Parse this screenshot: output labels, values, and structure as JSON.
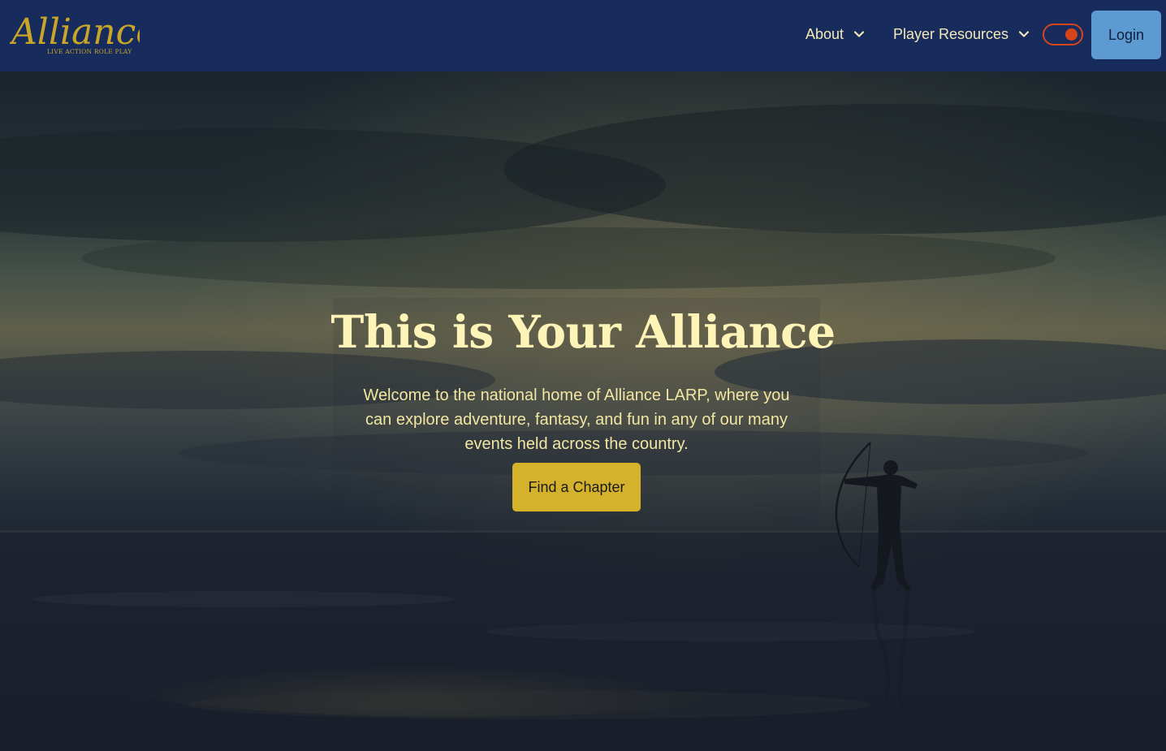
{
  "header": {
    "logo": {
      "wordmark": "Alliance",
      "tagline": "LIVE ACTION ROLE PLAY",
      "icon": "alliance-logo"
    },
    "nav": [
      {
        "label": "About",
        "icon": "chevron-down-icon"
      },
      {
        "label": "Player Resources",
        "icon": "chevron-down-icon"
      }
    ],
    "theme_toggle": {
      "state": "on",
      "icon": "toggle-switch"
    },
    "login_label": "Login"
  },
  "hero": {
    "title": "This is Your Alliance",
    "description": "Welcome to the national home of Alliance LARP, where you can explore adventure, fantasy, and fun in any of our many events held across the country.",
    "cta_label": "Find a Chapter",
    "background": "archer-on-beach-at-dusk"
  },
  "colors": {
    "navbar": "#172c5c",
    "logo_gold": "#c9a62a",
    "nav_text": "#f3e9b8",
    "toggle_accent": "#d4451b",
    "login_button": "#5d9ad2",
    "cta_button": "#d4b22c",
    "hero_title": "#fff4b8",
    "hero_text": "#f1e6a2"
  }
}
